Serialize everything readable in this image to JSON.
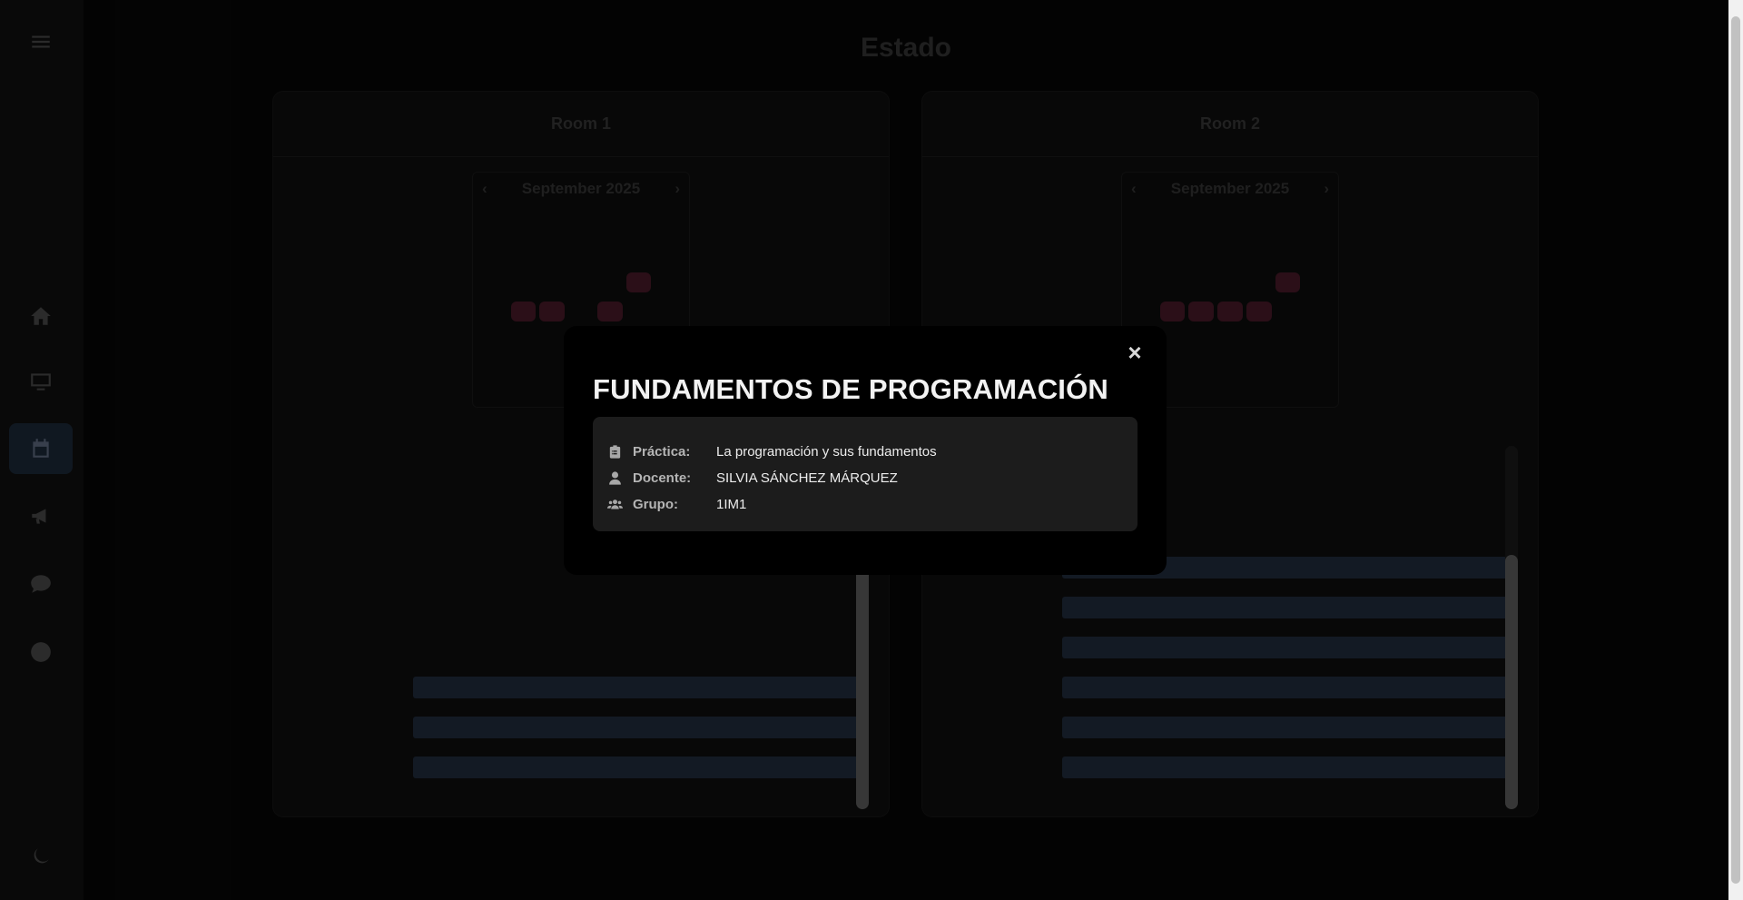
{
  "page": {
    "title": "Estado"
  },
  "sidebar": {
    "items": [
      {
        "name": "menu-icon"
      },
      {
        "name": "home-icon"
      },
      {
        "name": "monitor-icon"
      },
      {
        "name": "calendar-icon"
      },
      {
        "name": "megaphone-icon"
      },
      {
        "name": "chat-icon"
      },
      {
        "name": "help-icon"
      },
      {
        "name": "moon-icon"
      }
    ]
  },
  "rooms": [
    {
      "title": "Room 1",
      "month": "September 2025"
    },
    {
      "title": "Room 2",
      "month": "September 2025"
    }
  ],
  "modal": {
    "title": "FUNDAMENTOS DE PROGRAMACIÓN",
    "close_label": "×",
    "rows": [
      {
        "icon": "clipboard-icon",
        "label": "Práctica:",
        "value": "La programación y sus fundamentos"
      },
      {
        "icon": "user-icon",
        "label": "Docente:",
        "value": "SILVIA SÁNCHEZ MÁRQUEZ"
      },
      {
        "icon": "users-icon",
        "label": "Grupo:",
        "value": "1IM1"
      }
    ]
  },
  "colors": {
    "modal_bg": "#000000",
    "info_bg": "#1c1c1c",
    "overlay": "#050505"
  }
}
